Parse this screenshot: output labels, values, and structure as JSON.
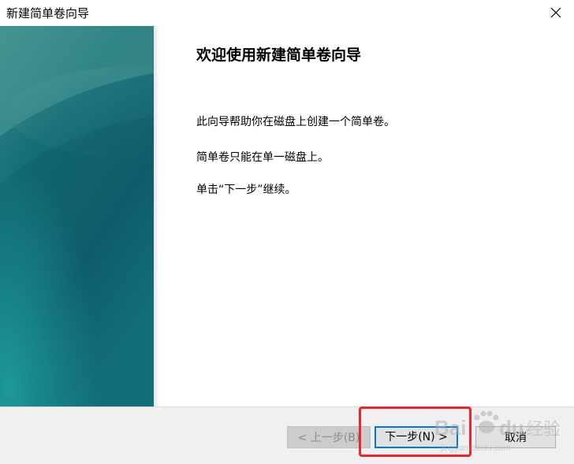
{
  "window": {
    "title": "新建简单卷向导"
  },
  "content": {
    "heading": "欢迎使用新建简单卷向导",
    "paragraphs": [
      "此向导帮助你在磁盘上创建一个简单卷。",
      "简单卷只能在单一磁盘上。",
      "单击“下一步”继续。"
    ]
  },
  "buttons": {
    "back": "< 上一步(B)",
    "next": "下一步(N) >",
    "cancel": "取消"
  },
  "icons": {
    "close": "close-icon"
  },
  "colors": {
    "side_panel_primary": "#0f6c78",
    "next_button_focus": "#0078d7",
    "annotation_red": "#e8262b"
  },
  "watermark": {
    "brand": "Baidu",
    "text": "经验",
    "domain": "jingyan.baidu.com"
  }
}
